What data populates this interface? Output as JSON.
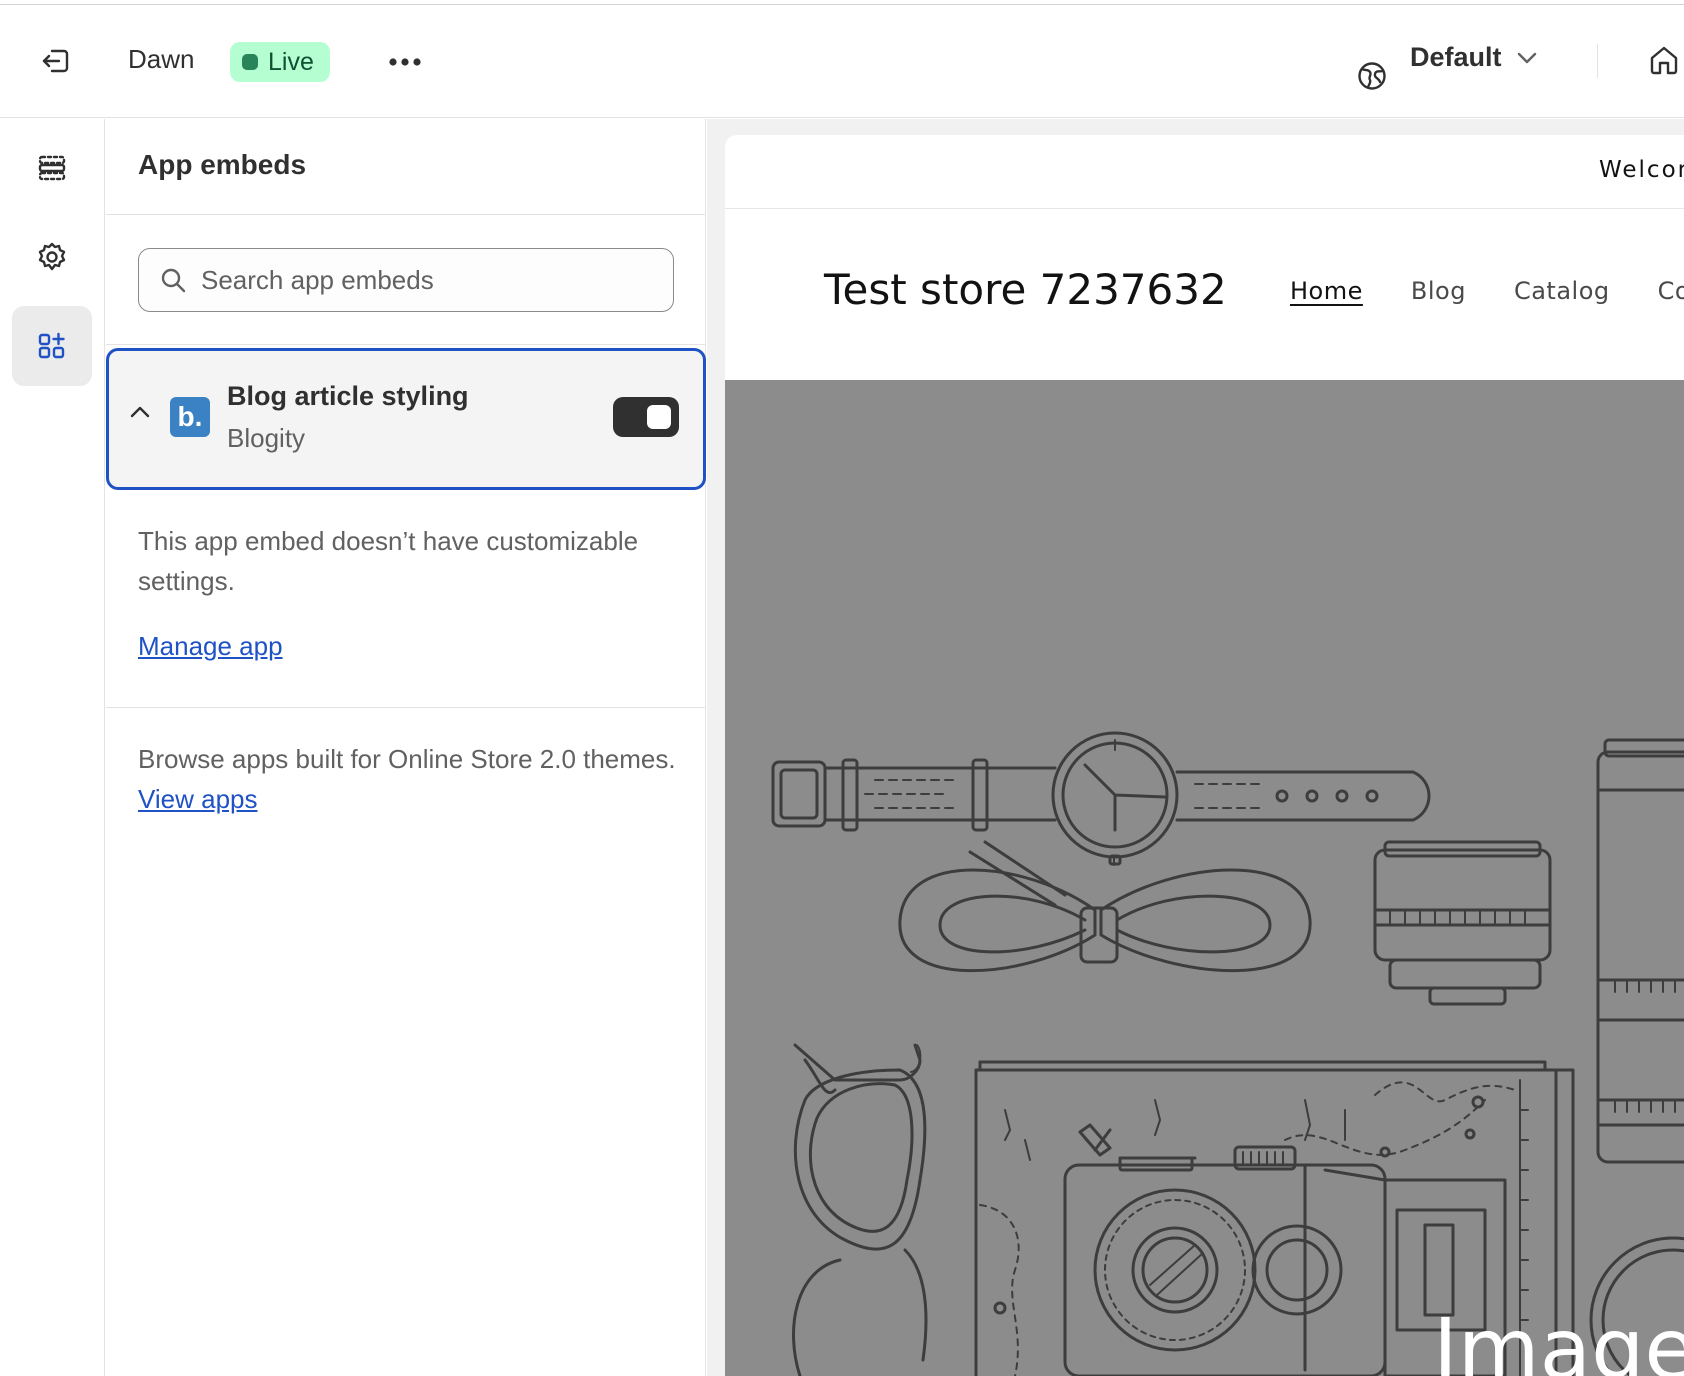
{
  "topbar": {
    "theme_name": "Dawn",
    "live_badge": "Live",
    "view_selector": "Default"
  },
  "panel": {
    "title": "App embeds",
    "search_placeholder": "Search app embeds",
    "embed": {
      "name": "Blog article styling",
      "vendor": "Blogity",
      "logo_letter": "b.",
      "enabled": true
    },
    "note": "This app embed doesn’t have customizable settings.",
    "manage_link": "Manage app",
    "browse_text": "Browse apps built for Online Store 2.0 themes.",
    "view_apps_link": "View apps"
  },
  "preview": {
    "announcement": "Welcom",
    "store_name": "Test store 7237632",
    "nav": [
      "Home",
      "Blog",
      "Catalog",
      "Co"
    ],
    "hero_text": "Image"
  },
  "colors": {
    "accent": "#1f52c5",
    "live_bg": "#b4fed2",
    "live_dot": "#29845a",
    "hero_bg": "#8c8c8c"
  },
  "icons": [
    "exit-icon",
    "more-horizontal-icon",
    "globe-icon",
    "chevron-down-icon",
    "home-icon",
    "sections-icon",
    "gear-icon",
    "app-embeds-icon",
    "search-icon",
    "chevron-up-icon"
  ]
}
